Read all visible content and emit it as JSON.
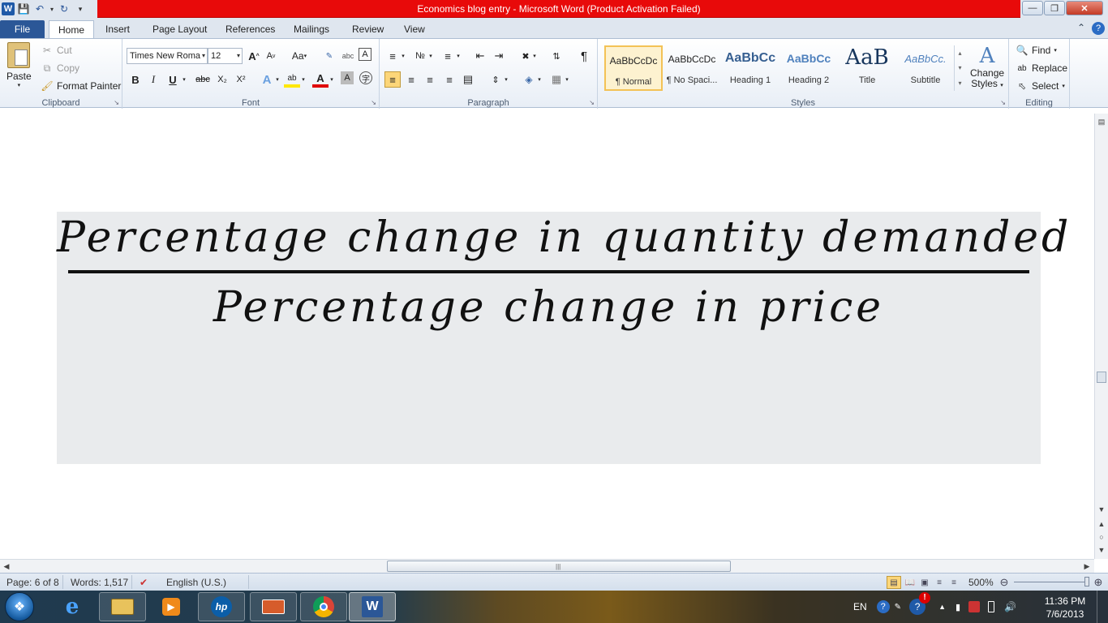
{
  "window": {
    "title": "Economics blog entry  -  Microsoft Word (Product Activation Failed)",
    "app_icon": "W",
    "controls": [
      "minimize",
      "maximize",
      "close"
    ]
  },
  "quick_access": {
    "icons": [
      "save-icon",
      "undo-icon",
      "redo-icon",
      "customize-icon"
    ]
  },
  "tabs": [
    {
      "label": "File"
    },
    {
      "label": "Home"
    },
    {
      "label": "Insert"
    },
    {
      "label": "Page Layout"
    },
    {
      "label": "References"
    },
    {
      "label": "Mailings"
    },
    {
      "label": "Review"
    },
    {
      "label": "View"
    }
  ],
  "active_tab": "Home",
  "ribbon": {
    "clipboard": {
      "label": "Clipboard",
      "paste": "Paste",
      "cut": "Cut",
      "copy": "Copy",
      "format_painter": "Format Painter"
    },
    "font": {
      "label": "Font",
      "font_name": "Times New Roma",
      "font_size": "12",
      "aa_label": "Aa",
      "bold": "B",
      "italic": "I",
      "underline": "U",
      "strike": "abc",
      "subscript": "X₂",
      "superscript": "X²"
    },
    "paragraph": {
      "label": "Paragraph",
      "pilcrow": "¶"
    },
    "styles": {
      "label": "Styles",
      "items": [
        {
          "preview": "AaBbCcDc",
          "name": "¶ Normal",
          "selected": true
        },
        {
          "preview": "AaBbCcDc",
          "name": "¶ No Spaci..."
        },
        {
          "preview": "AaBbCc",
          "name": "Heading 1"
        },
        {
          "preview": "AaBbCc",
          "name": "Heading 2"
        },
        {
          "preview": "AaB",
          "name": "Title"
        },
        {
          "preview": "AaBbCc.",
          "name": "Subtitle"
        }
      ],
      "change_styles": [
        "Change",
        "Styles"
      ]
    },
    "editing": {
      "label": "Editing",
      "find": "Find",
      "replace": "Replace",
      "select": "Select"
    }
  },
  "document": {
    "equation": {
      "numerator": "Percentage change in quantity demanded",
      "denominator": "Percentage change in price"
    }
  },
  "status_bar": {
    "page": "Page: 6 of 8",
    "words": "Words: 1,517",
    "language": "English (U.S.)",
    "zoom": "500%"
  },
  "taskbar": {
    "pinned": [
      "internet-explorer-icon",
      "file-explorer-icon",
      "media-player-icon",
      "hp-icon",
      "presentation-icon",
      "chrome-icon",
      "word-icon"
    ],
    "tray": {
      "language": "EN",
      "time": "11:36 PM",
      "date": "7/6/2013"
    }
  },
  "colors": {
    "activation_bar": "#e80a0a",
    "file_tab": "#2b5797",
    "selected_style": "#f3c256",
    "equation_bg": "#e9ebed"
  }
}
